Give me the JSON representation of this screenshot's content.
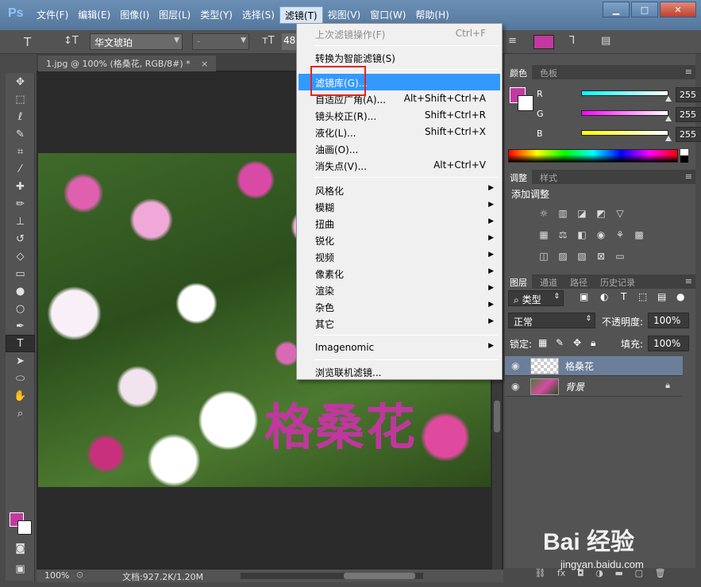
{
  "app": {
    "logo": "Ps"
  },
  "menubar": {
    "items": [
      "文件(F)",
      "编辑(E)",
      "图像(I)",
      "图层(L)",
      "类型(Y)",
      "选择(S)",
      "滤镜(T)",
      "视图(V)",
      "窗口(W)",
      "帮助(H)"
    ],
    "active_index": 6
  },
  "window_controls": {
    "minimize": "▁",
    "maximize": "□",
    "close": "✕"
  },
  "options": {
    "font_family": "华文琥珀",
    "font_style": "-",
    "font_size": "48",
    "text_color": "#c23aa0"
  },
  "document": {
    "tab_title": "1.jpg @ 100% (格桑花, RGB/8#) *",
    "tab_close": "×",
    "canvas_text": "格桑花",
    "status_zoom": "100%",
    "status_doc": "文档:927.2K/1.20M"
  },
  "filter_menu": {
    "items": [
      {
        "label": "上次滤镜操作(F)",
        "shortcut": "Ctrl+F",
        "disabled": true
      },
      {
        "label": "转换为智能滤镜(S)",
        "shortcut": ""
      },
      {
        "label": "滤镜库(G)...",
        "shortcut": "",
        "highlight": true
      },
      {
        "label": "自适应广角(A)...",
        "shortcut": "Alt+Shift+Ctrl+A"
      },
      {
        "label": "镜头校正(R)...",
        "shortcut": "Shift+Ctrl+R"
      },
      {
        "label": "液化(L)...",
        "shortcut": "Shift+Ctrl+X"
      },
      {
        "label": "油画(O)...",
        "shortcut": ""
      },
      {
        "label": "消失点(V)...",
        "shortcut": "Alt+Ctrl+V"
      },
      {
        "label": "风格化",
        "submenu": true
      },
      {
        "label": "模糊",
        "submenu": true
      },
      {
        "label": "扭曲",
        "submenu": true
      },
      {
        "label": "锐化",
        "submenu": true
      },
      {
        "label": "视频",
        "submenu": true
      },
      {
        "label": "像素化",
        "submenu": true
      },
      {
        "label": "渲染",
        "submenu": true
      },
      {
        "label": "杂色",
        "submenu": true
      },
      {
        "label": "其它",
        "submenu": true
      },
      {
        "label": "Imagenomic",
        "submenu": true
      },
      {
        "label": "浏览联机滤镜...",
        "shortcut": ""
      }
    ]
  },
  "color_panel": {
    "tabs": [
      "颜色",
      "色板"
    ],
    "r_label": "R",
    "r_value": "255",
    "g_label": "G",
    "g_value": "255",
    "b_label": "B",
    "b_value": "255"
  },
  "adjust_panel": {
    "tabs": [
      "调整",
      "样式"
    ],
    "title": "添加调整"
  },
  "layers_panel": {
    "tabs": [
      "图层",
      "通道",
      "路径",
      "历史记录"
    ],
    "filter_kind": "类型",
    "blend_mode": "正常",
    "opacity_label": "不透明度:",
    "opacity_value": "100%",
    "lock_label": "锁定:",
    "fill_label": "填充:",
    "fill_value": "100%",
    "layers": [
      {
        "name": "格桑花",
        "selected": true
      },
      {
        "name": "背景",
        "locked": true
      }
    ]
  },
  "watermark": {
    "text": "Bai 经验",
    "sub": "jingyan.baidu.com"
  }
}
